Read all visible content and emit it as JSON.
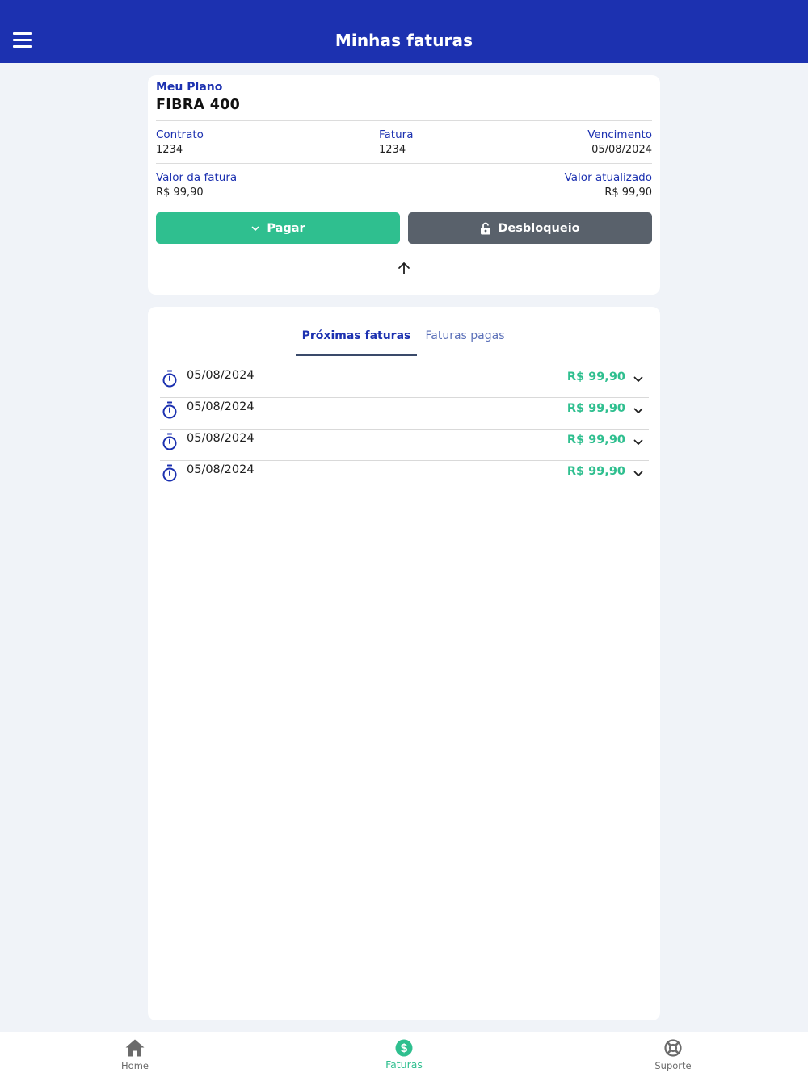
{
  "header": {
    "title": "Minhas faturas",
    "background_color": "#1c31b0",
    "menu_icon": "menu-icon"
  },
  "plan": {
    "label": "Meu Plano",
    "name": "FIBRA 400",
    "contrato_label": "Contrato",
    "contrato_value": "1234",
    "fatura_label": "Fatura",
    "fatura_value": "1234",
    "vencimento_label": "Vencimento",
    "vencimento_value": "05/08/2024",
    "valor_fatura_label": "Valor da fatura",
    "valor_fatura_value": "R$ 99,90",
    "valor_atualizado_label": "Valor atualizado",
    "valor_atualizado_value": "R$ 99,90"
  },
  "actions": {
    "pay_label": "Pagar",
    "pay_icon": "chevron-down-icon",
    "pay_color": "#2fbf8f",
    "unlock_label": "Desbloqueio",
    "unlock_icon": "lock-open-icon",
    "unlock_color": "#59616b",
    "collapse_icon": "arrow-up-icon"
  },
  "tabs": [
    {
      "label": "Próximas faturas",
      "active": true
    },
    {
      "label": "Faturas pagas",
      "active": false
    }
  ],
  "invoices": [
    {
      "date": "05/08/2024",
      "amount": "R$ 99,90",
      "icon": "timer-icon"
    },
    {
      "date": "05/08/2024",
      "amount": "R$ 99,90",
      "icon": "timer-icon"
    },
    {
      "date": "05/08/2024",
      "amount": "R$ 99,90",
      "icon": "timer-icon"
    },
    {
      "date": "05/08/2024",
      "amount": "R$ 99,90",
      "icon": "timer-icon"
    }
  ],
  "bottom_nav": {
    "items": [
      {
        "label": "Home",
        "icon": "home-icon",
        "active": false
      },
      {
        "label": "Faturas",
        "icon": "dollar-circle-icon",
        "active": true
      },
      {
        "label": "Suporte",
        "icon": "lifebuoy-icon",
        "active": false
      }
    ],
    "active_color": "#2fbf8f",
    "inactive_color": "#6b6b6b"
  }
}
